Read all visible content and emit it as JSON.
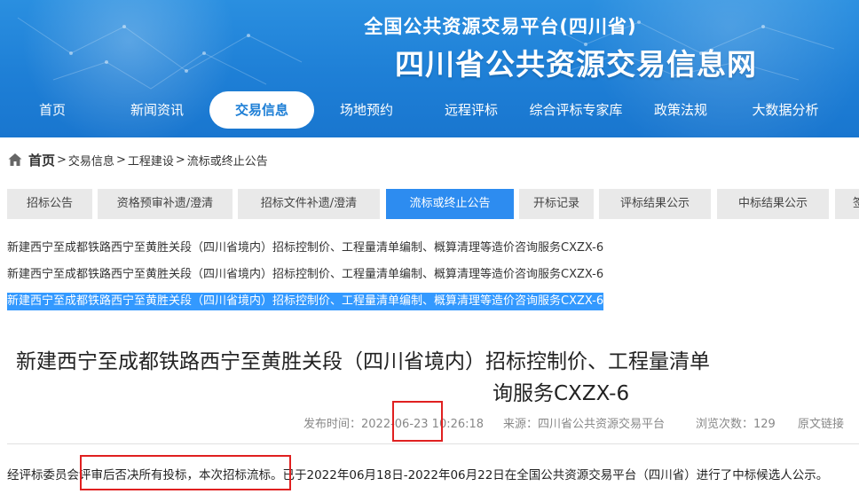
{
  "header": {
    "title_small": "全国公共资源交易平台(四川省)",
    "title_large": "四川省公共资源交易信息网"
  },
  "nav": [
    "首页",
    "新闻资讯",
    "交易信息",
    "场地预约",
    "远程评标",
    "综合评标专家库",
    "政策法规",
    "大数据分析"
  ],
  "nav_active": "交易信息",
  "breadcrumb": {
    "home": "首页",
    "sep": ">",
    "items": [
      "交易信息",
      "工程建设",
      "流标或终止公告"
    ]
  },
  "tabs": [
    "招标公告",
    "资格预审补遗/澄清",
    "招标文件补遗/澄清",
    "流标或终止公告",
    "开标记录",
    "评标结果公示",
    "中标结果公示",
    "签"
  ],
  "tabs_active": "流标或终止公告",
  "related_links": [
    "新建西宁至成都铁路西宁至黄胜关段（四川省境内）招标控制价、工程量清单编制、概算清理等造价咨询服务CXZX-6",
    "新建西宁至成都铁路西宁至黄胜关段（四川省境内）招标控制价、工程量清单编制、概算清理等造价咨询服务CXZX-6",
    "新建西宁至成都铁路西宁至黄胜关段（四川省境内）招标控制价、工程量清单编制、概算清理等造价咨询服务CXZX-6"
  ],
  "article": {
    "title_line1": "新建西宁至成都铁路西宁至黄胜关段（四川省境内）招标控制价、工程量清单",
    "title_line2": "询服务CXZX-6",
    "publish_time": "发布时间：2022-06-23 10:26:18",
    "source": "来源：四川省公共资源交易平台",
    "views": "浏览次数：129",
    "original_link": "原文链接",
    "body": "经评标委员会评审后否决所有投标，本次招标流标。已于2022年06月18日-2022年06月22日在全国公共资源交易平台（四川省）进行了中标候选人公示。"
  },
  "colors": {
    "banner": "#1e7fd6",
    "active_tab": "#2d8cf0",
    "highlight_box": "#e02020",
    "selection": "#3399ff"
  }
}
